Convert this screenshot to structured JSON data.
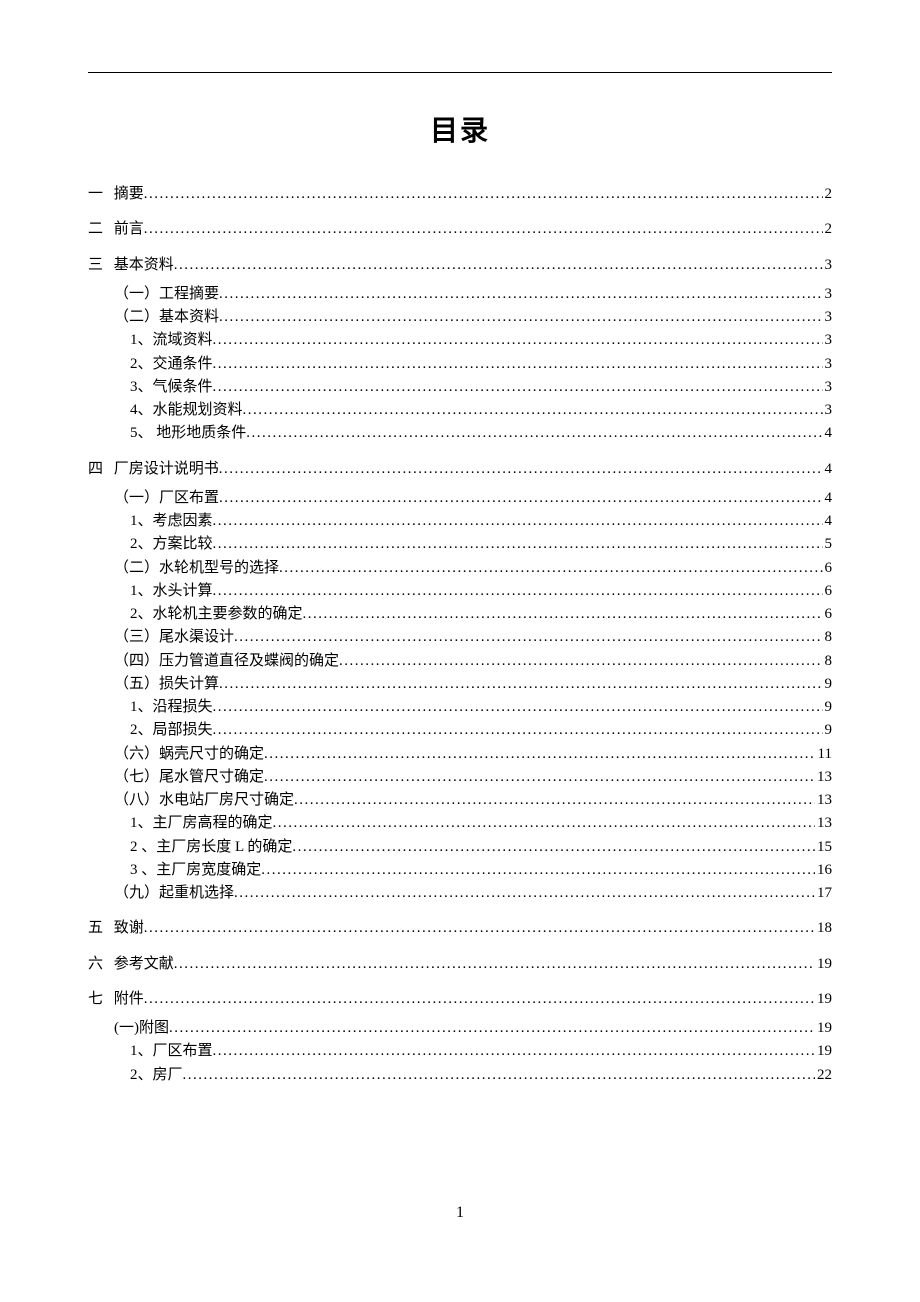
{
  "title": "目录",
  "pageNumber": "1",
  "toc": [
    {
      "level": 0,
      "num": "一",
      "label": "摘要",
      "page": "2"
    },
    {
      "level": 0,
      "num": "二",
      "label": "前言",
      "page": "2"
    },
    {
      "level": 0,
      "num": "三",
      "label": "基本资料",
      "page": "3"
    },
    {
      "level": 1,
      "num": "",
      "label": "（一）工程摘要",
      "page": "3"
    },
    {
      "level": 1,
      "num": "",
      "label": "（二）基本资料",
      "page": "3"
    },
    {
      "level": 2,
      "num": "",
      "label": "1、流域资料",
      "page": "3"
    },
    {
      "level": 2,
      "num": "",
      "label": "2、交通条件",
      "page": "3"
    },
    {
      "level": 2,
      "num": "",
      "label": "3、气候条件",
      "page": "3"
    },
    {
      "level": 2,
      "num": "",
      "label": "4、水能规划资料",
      "page": "3"
    },
    {
      "level": 2,
      "num": "",
      "label": "5、  地形地质条件",
      "page": "4"
    },
    {
      "level": 0,
      "num": "四",
      "label": "厂房设计说明书",
      "page": "4"
    },
    {
      "level": 1,
      "num": "",
      "label": "（一）厂区布置",
      "page": "4"
    },
    {
      "level": 2,
      "num": "",
      "label": "1、考虑因素",
      "page": "4"
    },
    {
      "level": 2,
      "num": "",
      "label": "2、方案比较",
      "page": "5"
    },
    {
      "level": 1,
      "num": "",
      "label": "（二）水轮机型号的选择",
      "page": "6"
    },
    {
      "level": 2,
      "num": "",
      "label": "1、水头计算",
      "page": "6"
    },
    {
      "level": 2,
      "num": "",
      "label": "2、水轮机主要参数的确定",
      "page": "6"
    },
    {
      "level": 1,
      "num": "",
      "label": "（三）尾水渠设计",
      "page": "8"
    },
    {
      "level": 1,
      "num": "",
      "label": "（四）压力管道直径及蝶阀的确定",
      "page": "8"
    },
    {
      "level": 1,
      "num": "",
      "label": "（五）损失计算",
      "page": "9"
    },
    {
      "level": 2,
      "num": "",
      "label": "1、沿程损失",
      "page": "9"
    },
    {
      "level": 2,
      "num": "",
      "label": "2、局部损失",
      "page": "9"
    },
    {
      "level": 1,
      "num": "",
      "label": "（六）蜗壳尺寸的确定",
      "page": "11"
    },
    {
      "level": 1,
      "num": "",
      "label": "（七）尾水管尺寸确定",
      "page": "13"
    },
    {
      "level": 1,
      "num": "",
      "label": "（八）水电站厂房尺寸确定",
      "page": "13"
    },
    {
      "level": 2,
      "num": "",
      "label": "1、主厂房高程的确定",
      "page": "13"
    },
    {
      "level": 2,
      "num": "",
      "label": "2 、主厂房长度 L 的确定",
      "page": "15"
    },
    {
      "level": 2,
      "num": "",
      "label": "3 、主厂房宽度确定",
      "page": "16"
    },
    {
      "level": 1,
      "num": "",
      "label": "（九）起重机选择",
      "page": "17"
    },
    {
      "level": 0,
      "num": "五",
      "label": "致谢",
      "page": "18"
    },
    {
      "level": 0,
      "num": "六",
      "label": "参考文献",
      "page": "19"
    },
    {
      "level": 0,
      "num": "七",
      "label": "附件",
      "page": "19"
    },
    {
      "level": 1,
      "num": "",
      "label": "(一)附图",
      "page": "19"
    },
    {
      "level": 2,
      "num": "",
      "label": "1、厂区布置",
      "page": "19"
    },
    {
      "level": 2,
      "num": "",
      "label": "2、房厂",
      "page": "22"
    }
  ]
}
